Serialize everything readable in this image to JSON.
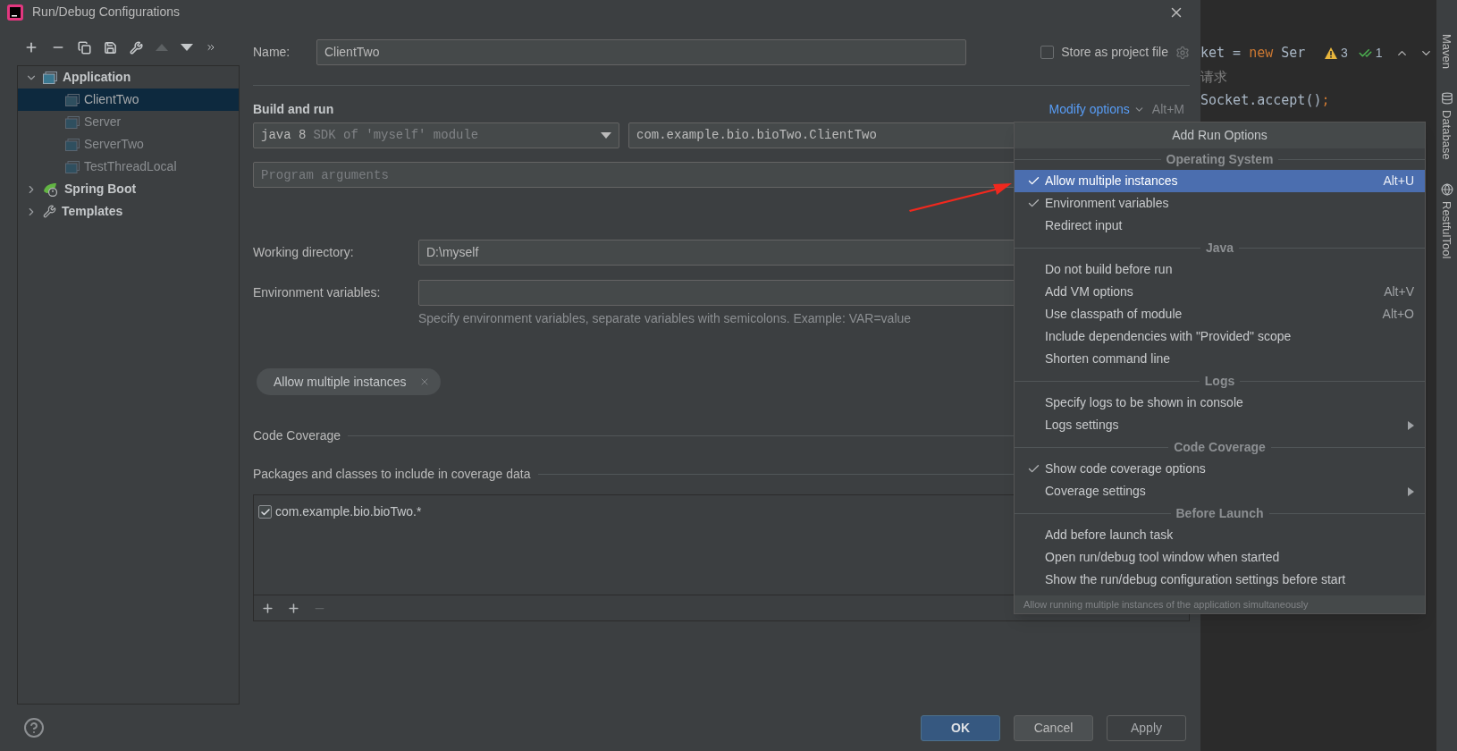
{
  "window": {
    "title": "Run/Debug Configurations"
  },
  "tree": [
    {
      "label": "Application",
      "kind": "application",
      "expanded": true,
      "selected": false,
      "children": [
        {
          "label": "ClientTwo",
          "selected": true
        },
        {
          "label": "Server",
          "selected": false
        },
        {
          "label": "ServerTwo",
          "selected": false
        },
        {
          "label": "TestThreadLocal",
          "selected": false
        }
      ]
    },
    {
      "label": "Spring Boot",
      "kind": "spring",
      "expanded": false,
      "selected": false
    },
    {
      "label": "Templates",
      "kind": "templates",
      "expanded": false,
      "selected": false
    }
  ],
  "form": {
    "name": {
      "label": "Name:",
      "value": "ClientTwo"
    },
    "store_as_project_file": {
      "label": "Store as project file",
      "checked": false
    },
    "build_and_run": {
      "title": "Build and run",
      "modify_options": "Modify options",
      "modify_shortcut": "Alt+M"
    },
    "jdk": {
      "value": "java 8",
      "hint": "SDK of 'myself' module"
    },
    "main_class": {
      "value": "com.example.bio.bioTwo.ClientTwo"
    },
    "program_arguments": {
      "placeholder": "Program arguments"
    },
    "working_directory": {
      "label": "Working directory:",
      "value": "D:\\myself"
    },
    "environment_variables": {
      "label": "Environment variables:",
      "hint": "Specify environment variables, separate variables with semicolons. Example: VAR=value"
    },
    "chips": [
      {
        "label": "Allow multiple instances"
      }
    ],
    "code_coverage": {
      "title": "Code Coverage",
      "packages_title": "Packages and classes to include in coverage data",
      "packages": [
        {
          "label": "com.example.bio.bioTwo.*",
          "checked": true
        }
      ]
    }
  },
  "footer": {
    "buttons": [
      {
        "label": "OK",
        "kind": "default",
        "disabled": false
      },
      {
        "label": "Cancel",
        "kind": "normal",
        "disabled": false
      },
      {
        "label": "Apply",
        "kind": "normal",
        "disabled": true
      }
    ]
  },
  "editor": {
    "lines": [
      {
        "parts": [
          {
            "text": "ket = ",
            "kind": "plain"
          },
          {
            "text": "new",
            "kind": "keyword"
          },
          {
            "text": " Ser",
            "kind": "plain"
          }
        ]
      },
      {
        "parts": [
          {
            "text": "请求",
            "kind": "comment"
          }
        ]
      },
      {
        "parts": [
          {
            "text": "Socket.accept()",
            "kind": "plain"
          },
          {
            "text": ";",
            "kind": "keyword"
          }
        ]
      }
    ],
    "warnings": "3",
    "weak_warnings": "1"
  },
  "tool_strip": [
    {
      "label": "Maven",
      "kind": "maven"
    },
    {
      "label": "Database",
      "kind": "database"
    },
    {
      "label": "RestfulTool",
      "kind": "restful"
    }
  ],
  "menu": {
    "title": "Add Run Options",
    "items": [
      {
        "kind": "section",
        "label": "Operating System"
      },
      {
        "kind": "item",
        "label": "Allow multiple instances",
        "checked": true,
        "selected": true,
        "shortcut": "Alt+U",
        "submenu": false
      },
      {
        "kind": "item",
        "label": "Environment variables",
        "checked": true,
        "selected": false,
        "submenu": false
      },
      {
        "kind": "item",
        "label": "Redirect input",
        "checked": false,
        "selected": false,
        "submenu": false
      },
      {
        "kind": "section",
        "label": "Java"
      },
      {
        "kind": "item",
        "label": "Do not build before run",
        "checked": false,
        "selected": false,
        "submenu": false
      },
      {
        "kind": "item",
        "label": "Add VM options",
        "checked": false,
        "selected": false,
        "shortcut": "Alt+V",
        "submenu": false
      },
      {
        "kind": "item",
        "label": "Use classpath of module",
        "checked": false,
        "selected": false,
        "shortcut": "Alt+O",
        "submenu": false
      },
      {
        "kind": "item",
        "label": "Include dependencies with \"Provided\" scope",
        "checked": false,
        "selected": false,
        "submenu": false
      },
      {
        "kind": "item",
        "label": "Shorten command line",
        "checked": false,
        "selected": false,
        "submenu": false
      },
      {
        "kind": "section",
        "label": "Logs"
      },
      {
        "kind": "item",
        "label": "Specify logs to be shown in console",
        "checked": false,
        "selected": false,
        "submenu": false
      },
      {
        "kind": "item",
        "label": "Logs settings",
        "checked": false,
        "selected": false,
        "submenu": true
      },
      {
        "kind": "section",
        "label": "Code Coverage"
      },
      {
        "kind": "item",
        "label": "Show code coverage options",
        "checked": true,
        "selected": false,
        "submenu": false
      },
      {
        "kind": "item",
        "label": "Coverage settings",
        "checked": false,
        "selected": false,
        "submenu": true
      },
      {
        "kind": "section",
        "label": "Before Launch"
      },
      {
        "kind": "item",
        "label": "Add before launch task",
        "checked": false,
        "selected": false,
        "submenu": false
      },
      {
        "kind": "item",
        "label": "Open run/debug tool window when started",
        "checked": false,
        "selected": false,
        "submenu": false
      },
      {
        "kind": "item",
        "label": "Show the run/debug configuration settings before start",
        "checked": false,
        "selected": false,
        "submenu": false
      }
    ],
    "hint": "Allow running multiple instances of the application simultaneously"
  }
}
